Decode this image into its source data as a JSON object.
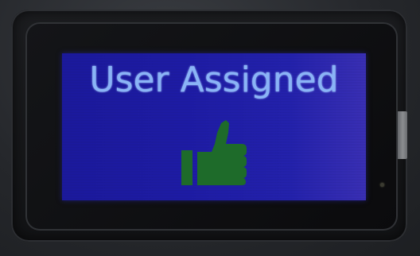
{
  "screen": {
    "message": "User Assigned",
    "icon": "thumbs-up-icon",
    "colors": {
      "background": "#1e1ca8",
      "text": "#8ab4f6",
      "icon": "#1e6b2a"
    }
  }
}
